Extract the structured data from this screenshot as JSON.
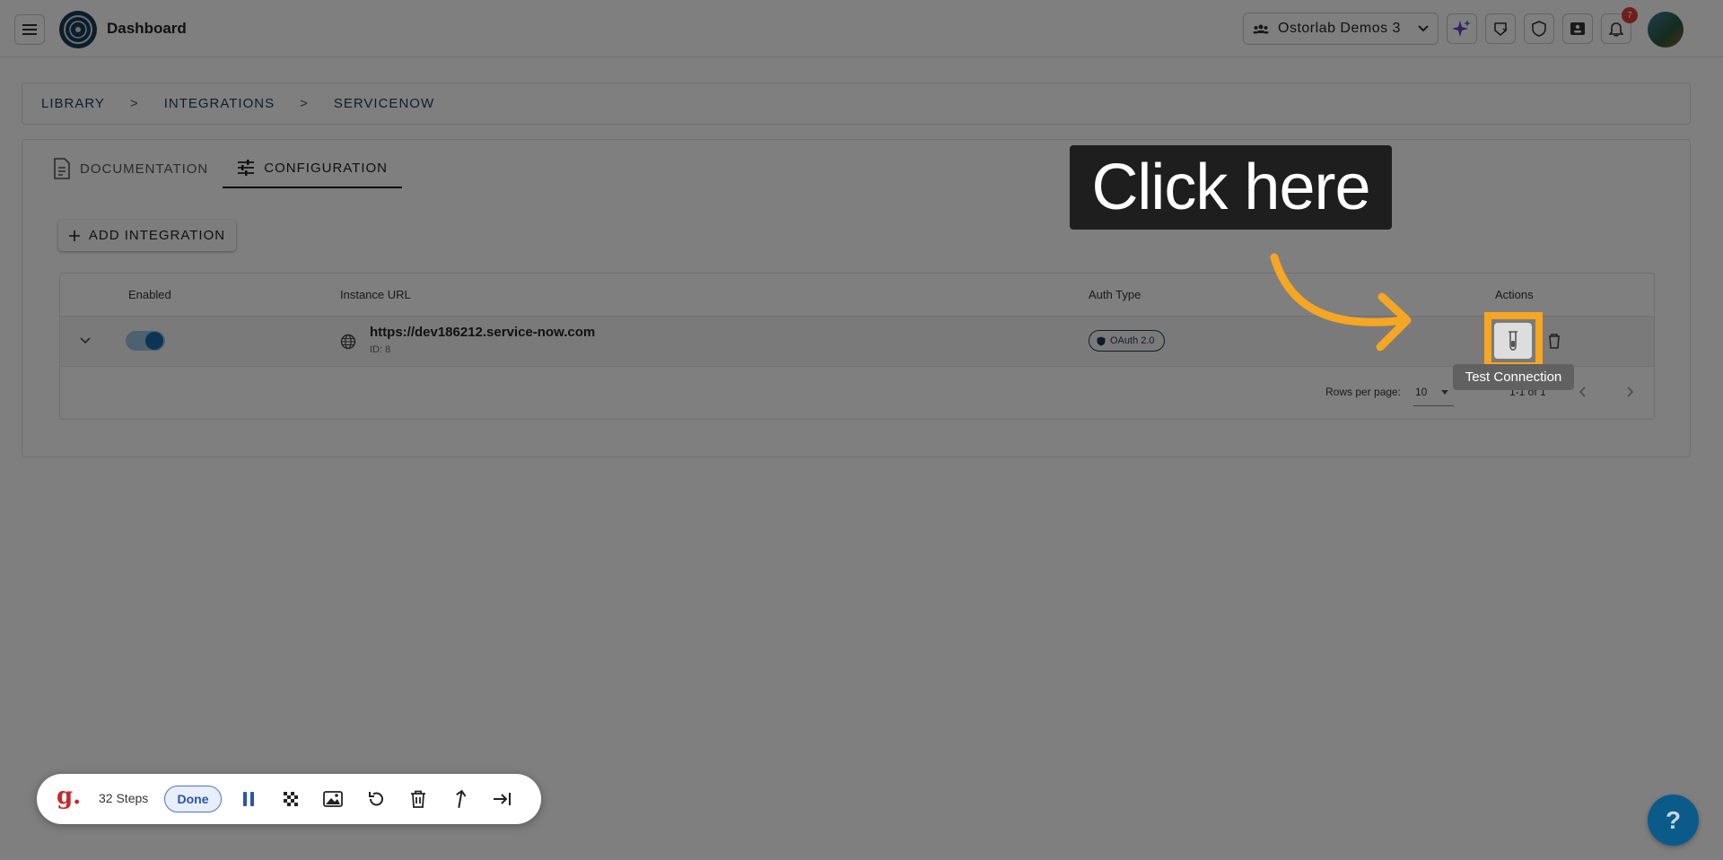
{
  "header": {
    "brand": "Dashboard",
    "org_name": "Ostorlab Demos 3",
    "notification_count": "7"
  },
  "breadcrumb": {
    "items": [
      "LIBRARY",
      "INTEGRATIONS",
      "SERVICENOW"
    ],
    "separator": ">"
  },
  "tabs": [
    {
      "label": "DOCUMENTATION",
      "icon": "document-icon",
      "active": false
    },
    {
      "label": "CONFIGURATION",
      "icon": "sliders-icon",
      "active": true
    }
  ],
  "add_button": {
    "label": "ADD INTEGRATION",
    "icon": "plus-icon"
  },
  "table": {
    "columns": [
      "Enabled",
      "Instance URL",
      "Auth Type",
      "Actions"
    ],
    "rows": [
      {
        "enabled": true,
        "url": "https://dev186212.service-now.com",
        "id_label": "ID: 8",
        "auth_type": "OAuth 2.0"
      }
    ],
    "footer": {
      "rows_per_page_label": "Rows per page:",
      "rows_per_page_value": "10",
      "range_label": "1-1 of 1"
    }
  },
  "overlay": {
    "callout_text": "Click here",
    "tooltip_text": "Test Connection",
    "highlight_color": "#f5a623"
  },
  "recorder": {
    "steps_label": "32 Steps",
    "done_label": "Done",
    "logo_text": "g."
  },
  "help": {
    "label": "?"
  }
}
